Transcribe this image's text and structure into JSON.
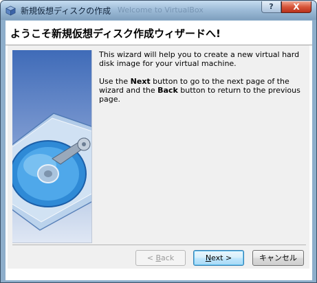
{
  "window": {
    "title": "新規仮想ディスクの作成",
    "ghost_title": "Welcome to VirtualBox",
    "help_label": "?",
    "close_label": "X"
  },
  "wizard": {
    "heading": "ようこそ新規仮想ディスク作成ウィザードへ!",
    "para1": "This wizard will help you to create a new virtual hard disk image for your virtual machine.",
    "para2_pre": "Use the ",
    "para2_next": "Next",
    "para2_mid": " button to go to the next page of the wizard and the ",
    "para2_back": "Back",
    "para2_post": " button to return to the previous page."
  },
  "buttons": {
    "back_arrow": "< ",
    "back_mnemonic": "B",
    "back_rest": "ack",
    "next_mnemonic": "N",
    "next_rest": "ext >",
    "cancel_label": "キャンセル"
  },
  "colors": {
    "accent": "#3c7fb1",
    "close": "#c8452c",
    "title_gradient_top": "#c6dcf0"
  },
  "icons": {
    "app": "virtualbox-cube-icon",
    "illustration": "hard-disk-illustration"
  }
}
